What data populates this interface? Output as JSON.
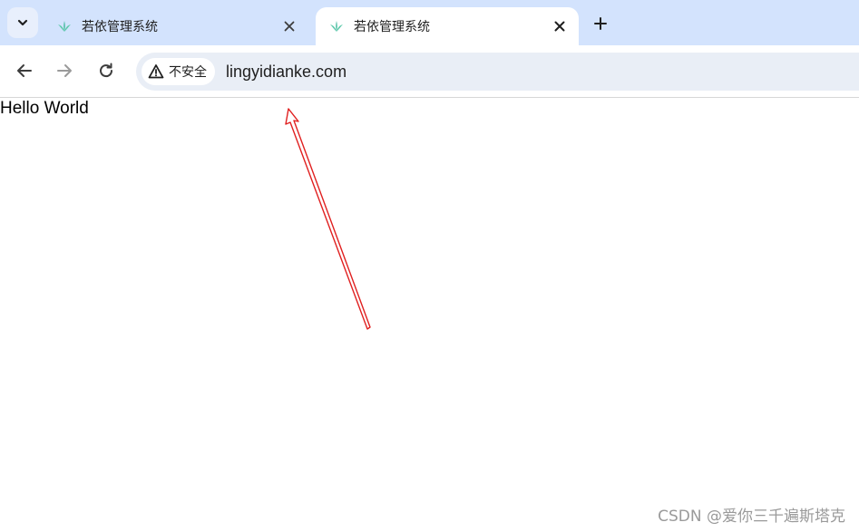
{
  "tabs": [
    {
      "title": "若依管理系统",
      "active": false
    },
    {
      "title": "若依管理系统",
      "active": true
    }
  ],
  "toolbar": {
    "security_label": "不安全",
    "url": "lingyidianke.com"
  },
  "page": {
    "body_text": "Hello World"
  },
  "watermark": "CSDN @爱你三千遍斯塔克",
  "colors": {
    "tabstrip": "#d3e3fd",
    "omnibox": "#e9eef6",
    "annotation_arrow": "#e02020",
    "favicon": "#3fb99b"
  },
  "icons": {
    "tab_search": "chevron-down-icon",
    "tab_close": "close-icon",
    "new_tab": "plus-icon",
    "back": "arrow-left-icon",
    "forward": "arrow-right-icon",
    "reload": "reload-icon",
    "security": "warning-triangle-icon",
    "favicon": "ruoyi-logo-icon"
  }
}
